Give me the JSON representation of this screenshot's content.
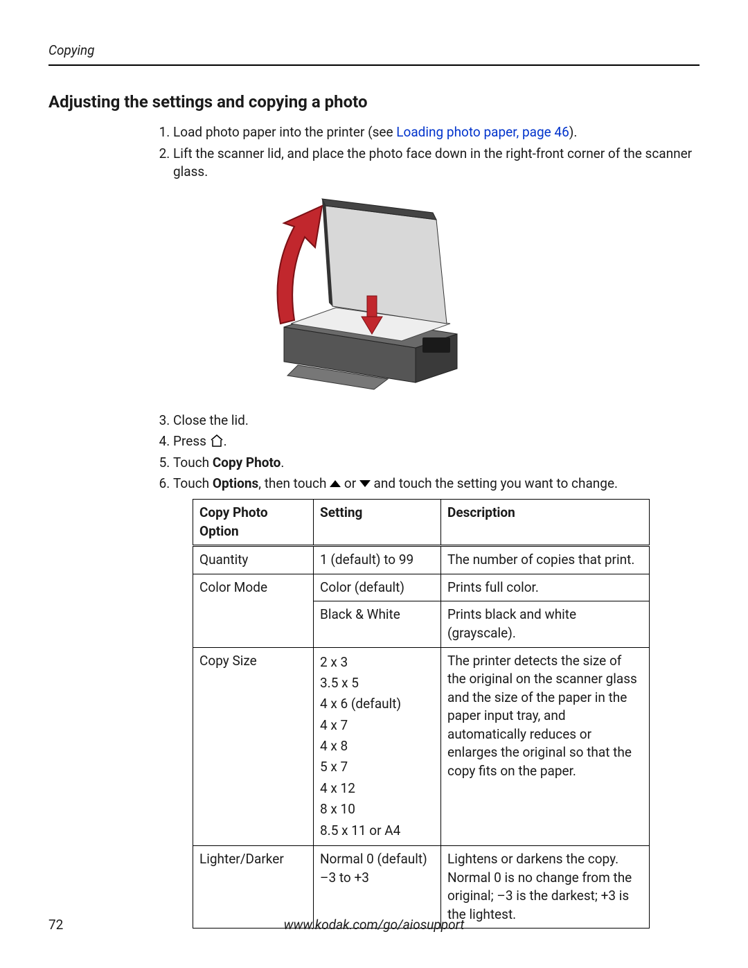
{
  "header": {
    "section": "Copying"
  },
  "title": "Adjusting the settings and copying a photo",
  "steps": {
    "s1_prefix": "Load photo paper into the printer (see ",
    "s1_link": "Loading photo paper, page 46",
    "s1_suffix": ").",
    "s2": "Lift the scanner lid, and place the photo face down in the right-front corner of the scanner glass.",
    "s3": "Close the lid.",
    "s4_prefix": "Press ",
    "s4_suffix": ".",
    "s5_prefix": "Touch ",
    "s5_bold": "Copy Photo",
    "s5_suffix": ".",
    "s6_prefix": "Touch ",
    "s6_bold": "Options",
    "s6_mid1": ", then touch ",
    "s6_or": " or ",
    "s6_mid2": " and touch the setting you want to change."
  },
  "table": {
    "headers": {
      "c1": "Copy Photo Option",
      "c2": "Setting",
      "c3": "Description"
    },
    "quantity": {
      "option": "Quantity",
      "setting": "1 (default) to 99",
      "desc": "The number of copies that print."
    },
    "color1": {
      "option": "Color Mode",
      "setting": "Color (default)",
      "desc": "Prints full color."
    },
    "color2": {
      "setting": "Black & White",
      "desc": "Prints black and white (grayscale)."
    },
    "size": {
      "option": "Copy Size",
      "settings": [
        "2 x 3",
        "3.5 x 5",
        "4 x 6 (default)",
        "4 x 7",
        "4 x 8",
        "5 x 7",
        "4 x 12",
        "8 x 10",
        "8.5 x 11 or A4"
      ],
      "desc": "The printer detects the size of the original on the scanner glass and the size of the paper in the paper input tray, and automatically reduces or enlarges the original so that the copy fits on the paper."
    },
    "lightdark": {
      "option": "Lighter/Darker",
      "setting1": "Normal 0 (default)",
      "setting2": "–3 to +3",
      "desc1": "Lightens or darkens the copy.",
      "desc2": "Normal 0 is no change from the original; –3 is the darkest; +3 is the lightest."
    }
  },
  "footer": {
    "page": "72",
    "url": "www.kodak.com/go/aiosupport"
  }
}
